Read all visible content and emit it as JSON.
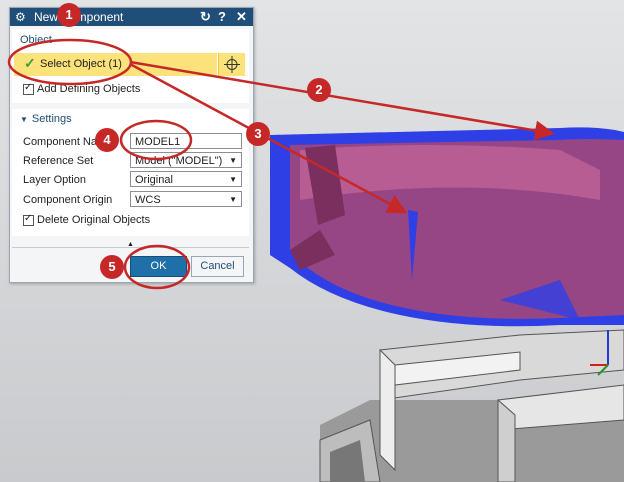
{
  "dialog": {
    "title": "New Component",
    "title_icons": [
      "gear-icon",
      "reset-icon",
      "help-icon",
      "close-icon"
    ],
    "reset_glyph": "↻",
    "help_glyph": "?",
    "close_glyph": "✕",
    "object_section": {
      "title": "Object",
      "select_label": "Select Object (1)",
      "add_defining": "Add Defining Objects"
    },
    "settings_section": {
      "title": "Settings",
      "component_name_label": "Component Name",
      "component_name_value": "MODEL1",
      "reference_set_label": "Reference Set",
      "reference_set_value": "Model (\"MODEL\")",
      "layer_option_label": "Layer Option",
      "layer_option_value": "Original",
      "component_origin_label": "Component Origin",
      "component_origin_value": "WCS",
      "delete_original": "Delete Original Objects"
    },
    "ok_label": "OK",
    "cancel_label": "Cancel"
  },
  "callouts": [
    "1",
    "2",
    "3",
    "4",
    "5"
  ],
  "colors": {
    "title_bar": "#1f4e79",
    "selection_highlight": "#fbe27a",
    "callout": "#c62828",
    "ok": "#1f6fa8"
  }
}
